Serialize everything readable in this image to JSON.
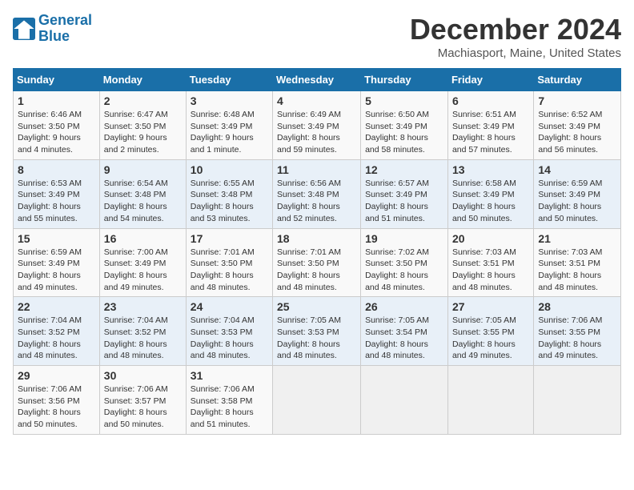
{
  "header": {
    "logo_line1": "General",
    "logo_line2": "Blue",
    "month": "December 2024",
    "location": "Machiasport, Maine, United States"
  },
  "columns": [
    "Sunday",
    "Monday",
    "Tuesday",
    "Wednesday",
    "Thursday",
    "Friday",
    "Saturday"
  ],
  "weeks": [
    [
      {
        "day": "1",
        "info": "Sunrise: 6:46 AM\nSunset: 3:50 PM\nDaylight: 9 hours\nand 4 minutes."
      },
      {
        "day": "2",
        "info": "Sunrise: 6:47 AM\nSunset: 3:50 PM\nDaylight: 9 hours\nand 2 minutes."
      },
      {
        "day": "3",
        "info": "Sunrise: 6:48 AM\nSunset: 3:49 PM\nDaylight: 9 hours\nand 1 minute."
      },
      {
        "day": "4",
        "info": "Sunrise: 6:49 AM\nSunset: 3:49 PM\nDaylight: 8 hours\nand 59 minutes."
      },
      {
        "day": "5",
        "info": "Sunrise: 6:50 AM\nSunset: 3:49 PM\nDaylight: 8 hours\nand 58 minutes."
      },
      {
        "day": "6",
        "info": "Sunrise: 6:51 AM\nSunset: 3:49 PM\nDaylight: 8 hours\nand 57 minutes."
      },
      {
        "day": "7",
        "info": "Sunrise: 6:52 AM\nSunset: 3:49 PM\nDaylight: 8 hours\nand 56 minutes."
      }
    ],
    [
      {
        "day": "8",
        "info": "Sunrise: 6:53 AM\nSunset: 3:49 PM\nDaylight: 8 hours\nand 55 minutes."
      },
      {
        "day": "9",
        "info": "Sunrise: 6:54 AM\nSunset: 3:48 PM\nDaylight: 8 hours\nand 54 minutes."
      },
      {
        "day": "10",
        "info": "Sunrise: 6:55 AM\nSunset: 3:48 PM\nDaylight: 8 hours\nand 53 minutes."
      },
      {
        "day": "11",
        "info": "Sunrise: 6:56 AM\nSunset: 3:48 PM\nDaylight: 8 hours\nand 52 minutes."
      },
      {
        "day": "12",
        "info": "Sunrise: 6:57 AM\nSunset: 3:49 PM\nDaylight: 8 hours\nand 51 minutes."
      },
      {
        "day": "13",
        "info": "Sunrise: 6:58 AM\nSunset: 3:49 PM\nDaylight: 8 hours\nand 50 minutes."
      },
      {
        "day": "14",
        "info": "Sunrise: 6:59 AM\nSunset: 3:49 PM\nDaylight: 8 hours\nand 50 minutes."
      }
    ],
    [
      {
        "day": "15",
        "info": "Sunrise: 6:59 AM\nSunset: 3:49 PM\nDaylight: 8 hours\nand 49 minutes."
      },
      {
        "day": "16",
        "info": "Sunrise: 7:00 AM\nSunset: 3:49 PM\nDaylight: 8 hours\nand 49 minutes."
      },
      {
        "day": "17",
        "info": "Sunrise: 7:01 AM\nSunset: 3:50 PM\nDaylight: 8 hours\nand 48 minutes."
      },
      {
        "day": "18",
        "info": "Sunrise: 7:01 AM\nSunset: 3:50 PM\nDaylight: 8 hours\nand 48 minutes."
      },
      {
        "day": "19",
        "info": "Sunrise: 7:02 AM\nSunset: 3:50 PM\nDaylight: 8 hours\nand 48 minutes."
      },
      {
        "day": "20",
        "info": "Sunrise: 7:03 AM\nSunset: 3:51 PM\nDaylight: 8 hours\nand 48 minutes."
      },
      {
        "day": "21",
        "info": "Sunrise: 7:03 AM\nSunset: 3:51 PM\nDaylight: 8 hours\nand 48 minutes."
      }
    ],
    [
      {
        "day": "22",
        "info": "Sunrise: 7:04 AM\nSunset: 3:52 PM\nDaylight: 8 hours\nand 48 minutes."
      },
      {
        "day": "23",
        "info": "Sunrise: 7:04 AM\nSunset: 3:52 PM\nDaylight: 8 hours\nand 48 minutes."
      },
      {
        "day": "24",
        "info": "Sunrise: 7:04 AM\nSunset: 3:53 PM\nDaylight: 8 hours\nand 48 minutes."
      },
      {
        "day": "25",
        "info": "Sunrise: 7:05 AM\nSunset: 3:53 PM\nDaylight: 8 hours\nand 48 minutes."
      },
      {
        "day": "26",
        "info": "Sunrise: 7:05 AM\nSunset: 3:54 PM\nDaylight: 8 hours\nand 48 minutes."
      },
      {
        "day": "27",
        "info": "Sunrise: 7:05 AM\nSunset: 3:55 PM\nDaylight: 8 hours\nand 49 minutes."
      },
      {
        "day": "28",
        "info": "Sunrise: 7:06 AM\nSunset: 3:55 PM\nDaylight: 8 hours\nand 49 minutes."
      }
    ],
    [
      {
        "day": "29",
        "info": "Sunrise: 7:06 AM\nSunset: 3:56 PM\nDaylight: 8 hours\nand 50 minutes."
      },
      {
        "day": "30",
        "info": "Sunrise: 7:06 AM\nSunset: 3:57 PM\nDaylight: 8 hours\nand 50 minutes."
      },
      {
        "day": "31",
        "info": "Sunrise: 7:06 AM\nSunset: 3:58 PM\nDaylight: 8 hours\nand 51 minutes."
      },
      null,
      null,
      null,
      null
    ]
  ]
}
